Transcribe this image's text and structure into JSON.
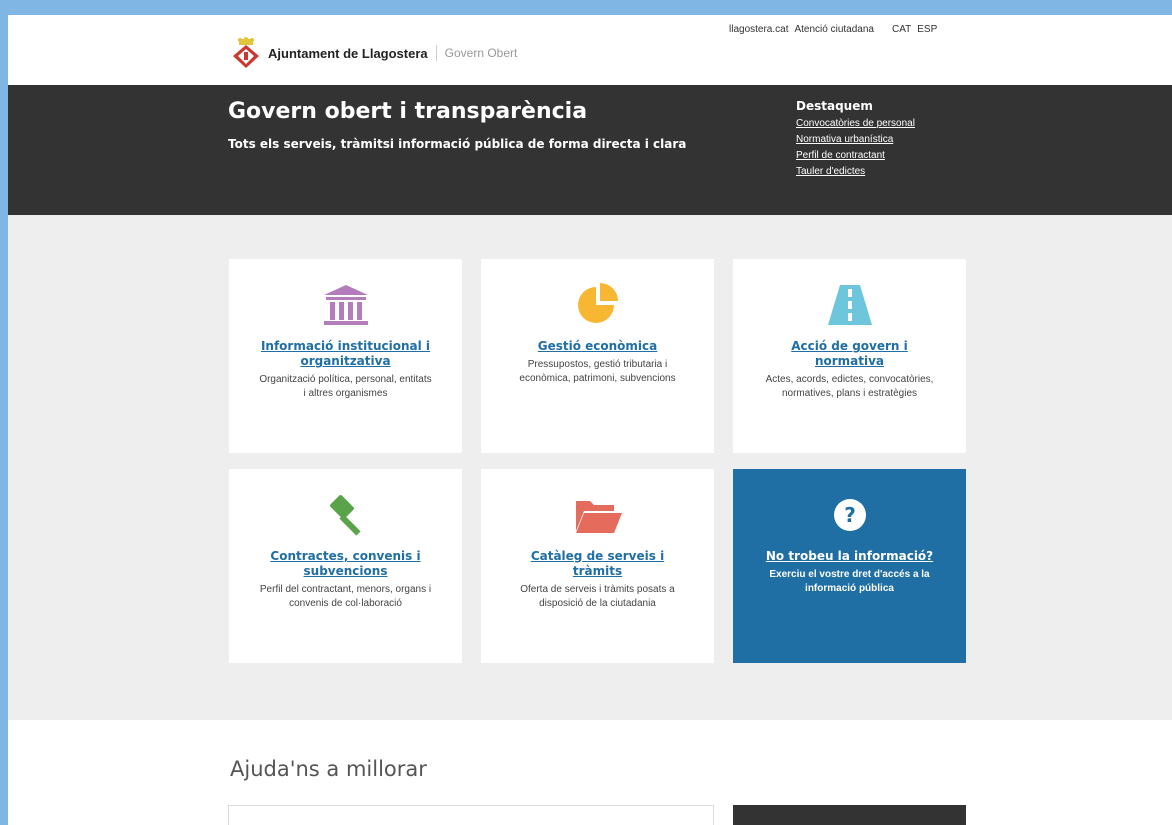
{
  "header": {
    "brand": "Ajuntament de Llagostera",
    "brand_sub": "Govern Obert",
    "links": [
      "llagostera.cat",
      "Atenció ciutadana"
    ],
    "languages": [
      "CAT",
      "ESP"
    ]
  },
  "hero": {
    "title": "Govern obert i transparència",
    "subtitle": "Tots els serveis, tràmitsi informació pública de forma directa i clara",
    "featured_title": "Destaquem",
    "featured_links": [
      "Convocatòries de personal",
      "Normativa urbanística",
      "Perfil de contractant",
      "Tauler d'edictes"
    ]
  },
  "cards": [
    {
      "title": "Informació institucional i organitzativa",
      "desc": "Organització política, personal, entitats i altres organismes",
      "icon": "institution-icon"
    },
    {
      "title": "Gestió econòmica",
      "desc": "Pressupostos, gestió tributaria i econòmica, patrimoni, subvencions",
      "icon": "pie-chart-icon"
    },
    {
      "title": "Acció de govern i normativa",
      "desc": "Actes, acords, edictes, convocatòries, normatives, plans i estratègies",
      "icon": "road-icon"
    },
    {
      "title": "Contractes, convenis i subvencions",
      "desc": "Perfil del contractant, menors, organs i convenis de col·laboració",
      "icon": "gavel-icon"
    },
    {
      "title": "Catàleg de serveis i tràmits",
      "desc": "Oferta de serveis i tràmits posats a disposició de la ciutadania",
      "icon": "folder-icon"
    },
    {
      "title": "No trobeu la informació?",
      "desc": "Exerciu el vostre dret d'accés a la informació pública",
      "icon": "question-icon"
    }
  ],
  "colors": {
    "purple": "#b37dbb",
    "orange": "#f7b733",
    "teal": "#6ec6dd",
    "green": "#5ba34a",
    "red": "#e56b5d",
    "blue": "#1f6ea4"
  },
  "help": {
    "title": "Ajuda'ns a millorar"
  }
}
